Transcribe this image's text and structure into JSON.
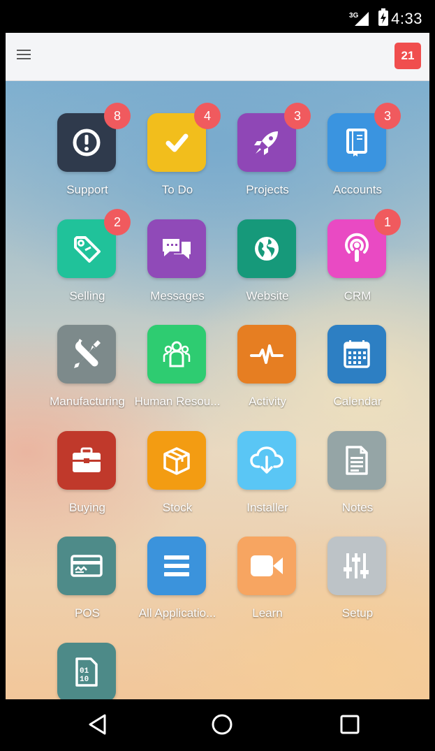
{
  "status_bar": {
    "network": "3G",
    "time": "4:33"
  },
  "app_bar": {
    "menu_icon": "hamburger-icon",
    "notification_count": "21"
  },
  "colors": {
    "accent_red": "#f04e4e",
    "badge_red": "#f05a5e"
  },
  "apps": [
    {
      "name": "Support",
      "badge": "8",
      "icon": "alert-circle-icon",
      "color": "#2f3a4c"
    },
    {
      "name": "To Do",
      "badge": "4",
      "icon": "check-icon",
      "color": "#f2be1c"
    },
    {
      "name": "Projects",
      "badge": "3",
      "icon": "rocket-icon",
      "color": "#8f47b6"
    },
    {
      "name": "Accounts",
      "badge": "3",
      "icon": "book-icon",
      "color": "#3a94e0"
    },
    {
      "name": "Selling",
      "badge": "2",
      "icon": "tag-icon",
      "color": "#20c29a"
    },
    {
      "name": "Messages",
      "badge": "",
      "icon": "chat-bubbles-icon",
      "color": "#904ab8"
    },
    {
      "name": "Website",
      "badge": "",
      "icon": "globe-icon",
      "color": "#16997a"
    },
    {
      "name": "CRM",
      "badge": "1",
      "icon": "podcast-icon",
      "color": "#e94ac3"
    },
    {
      "name": "Manufacturing",
      "badge": "",
      "icon": "tools-icon",
      "color": "#7d8a8b"
    },
    {
      "name": "Human Resou...",
      "badge": "",
      "icon": "people-icon",
      "color": "#2ecc71"
    },
    {
      "name": "Activity",
      "badge": "",
      "icon": "pulse-icon",
      "color": "#e67e22"
    },
    {
      "name": "Calendar",
      "badge": "",
      "icon": "calendar-icon",
      "color": "#2d7fc3"
    },
    {
      "name": "Buying",
      "badge": "",
      "icon": "briefcase-icon",
      "color": "#c0392b"
    },
    {
      "name": "Stock",
      "badge": "",
      "icon": "box-icon",
      "color": "#f39c12"
    },
    {
      "name": "Installer",
      "badge": "",
      "icon": "cloud-download-icon",
      "color": "#5ac6f5"
    },
    {
      "name": "Notes",
      "badge": "",
      "icon": "document-icon",
      "color": "#95a5a6"
    },
    {
      "name": "POS",
      "badge": "",
      "icon": "credit-card-icon",
      "color": "#4e8b89"
    },
    {
      "name": "All Applicatio...",
      "badge": "",
      "icon": "list-icon",
      "color": "#3b93dc"
    },
    {
      "name": "Learn",
      "badge": "",
      "icon": "video-camera-icon",
      "color": "#f7a561"
    },
    {
      "name": "Setup",
      "badge": "",
      "icon": "sliders-icon",
      "color": "#bdc3c7"
    },
    {
      "name": "",
      "badge": "",
      "icon": "binary-file-icon",
      "color": "#4d8a88"
    }
  ],
  "nav_bar": {
    "back": "back-triangle-icon",
    "home": "home-circle-icon",
    "recents": "recents-square-icon"
  }
}
